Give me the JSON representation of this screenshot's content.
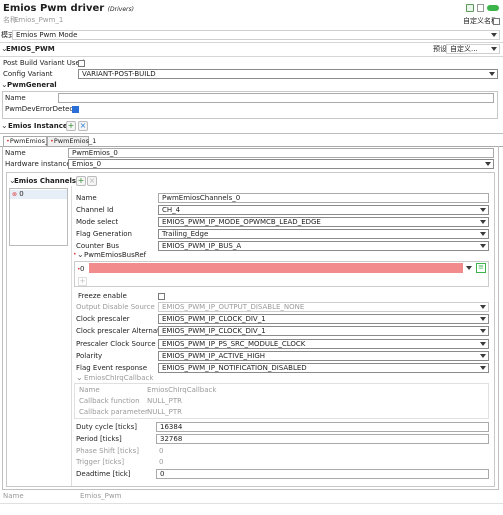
{
  "header": {
    "title": "Emios Pwm driver",
    "subtitle": "(Drivers)",
    "name_label": "名称:",
    "name_value": "Emios_Pwm_1",
    "custom_name_label": "自定义名称",
    "mode_label": "模式",
    "mode_value": "Emios Pwm Mode"
  },
  "section_emios_pwm": {
    "title": "EMIOS_PWM",
    "preset_label": "预设",
    "preset_value": "自定义..."
  },
  "post_build": {
    "label": "Post Build Variant Used"
  },
  "config_variant": {
    "label": "Config Variant",
    "value": "VARIANT-POST-BUILD"
  },
  "pwm_general": {
    "title": "PwmGeneral",
    "name_label": "Name",
    "dev_error_label": "PwmDevErrorDetect"
  },
  "emios_instance": {
    "title": "Emios Instance",
    "tabs": [
      "PwmEmios_0",
      "PwmEmios_1"
    ],
    "name_label": "Name",
    "name_value": "PwmEmios_0",
    "hw_label": "Hardware instance",
    "hw_value": "Emios_0"
  },
  "channels": {
    "title": "Emios Channels",
    "list": [
      "0"
    ],
    "fields": [
      {
        "label": "Name",
        "value": "PwmEmiosChannels_0",
        "kind": "input"
      },
      {
        "label": "Channel Id",
        "value": "CH_4",
        "kind": "select"
      },
      {
        "label": "Mode select",
        "value": "EMIOS_PWM_IP_MODE_OPWMCB_LEAD_EDGE",
        "kind": "select"
      },
      {
        "label": "Flag Generation",
        "value": "Trailing_Edge",
        "kind": "select"
      },
      {
        "label": "Counter Bus",
        "value": "EMIOS_PWM_IP_BUS_A",
        "kind": "select"
      }
    ],
    "busref_label": "PwmEmiosBusRef",
    "busref_index": "0",
    "freeze_label": "Freeze enable",
    "fields2": [
      {
        "label": "Output Disable Source",
        "value": "EMIOS_PWM_IP_OUTPUT_DISABLE_NONE",
        "disabled": true
      },
      {
        "label": "Clock prescaler",
        "value": "EMIOS_PWM_IP_CLOCK_DIV_1",
        "disabled": false
      },
      {
        "label": "Clock prescaler Alternate",
        "value": "EMIOS_PWM_IP_CLOCK_DIV_1",
        "disabled": false
      },
      {
        "label": "Prescaler Clock Source",
        "value": "EMIOS_PWM_IP_PS_SRC_MODULE_CLOCK",
        "disabled": false
      },
      {
        "label": "Polarity",
        "value": "EMIOS_PWM_IP_ACTIVE_HIGH",
        "disabled": false
      },
      {
        "label": "Flag Event response",
        "value": "EMIOS_PWM_IP_NOTIFICATION_DISABLED",
        "disabled": false
      }
    ],
    "callback": {
      "title": "EmiosChIrqCallback",
      "rows": [
        {
          "label": "Name",
          "value": "EmiosChIrqCallback"
        },
        {
          "label": "Callback function",
          "value": "NULL_PTR"
        },
        {
          "label": "Callback parameter",
          "value": "NULL_PTR"
        }
      ]
    },
    "ticks": [
      {
        "label": "Duty cycle [ticks]",
        "value": "16384",
        "disabled": false
      },
      {
        "label": "Period [ticks]",
        "value": "32768",
        "disabled": false
      },
      {
        "label": "Phase Shift [ticks]",
        "value": "0",
        "disabled": true
      },
      {
        "label": "Trigger [ticks]",
        "value": "0",
        "disabled": true
      },
      {
        "label": "Deadtime [tick]",
        "value": "0",
        "disabled": false
      }
    ]
  },
  "footer": {
    "name_label": "Name",
    "name_value": "Emios_Pwm"
  }
}
